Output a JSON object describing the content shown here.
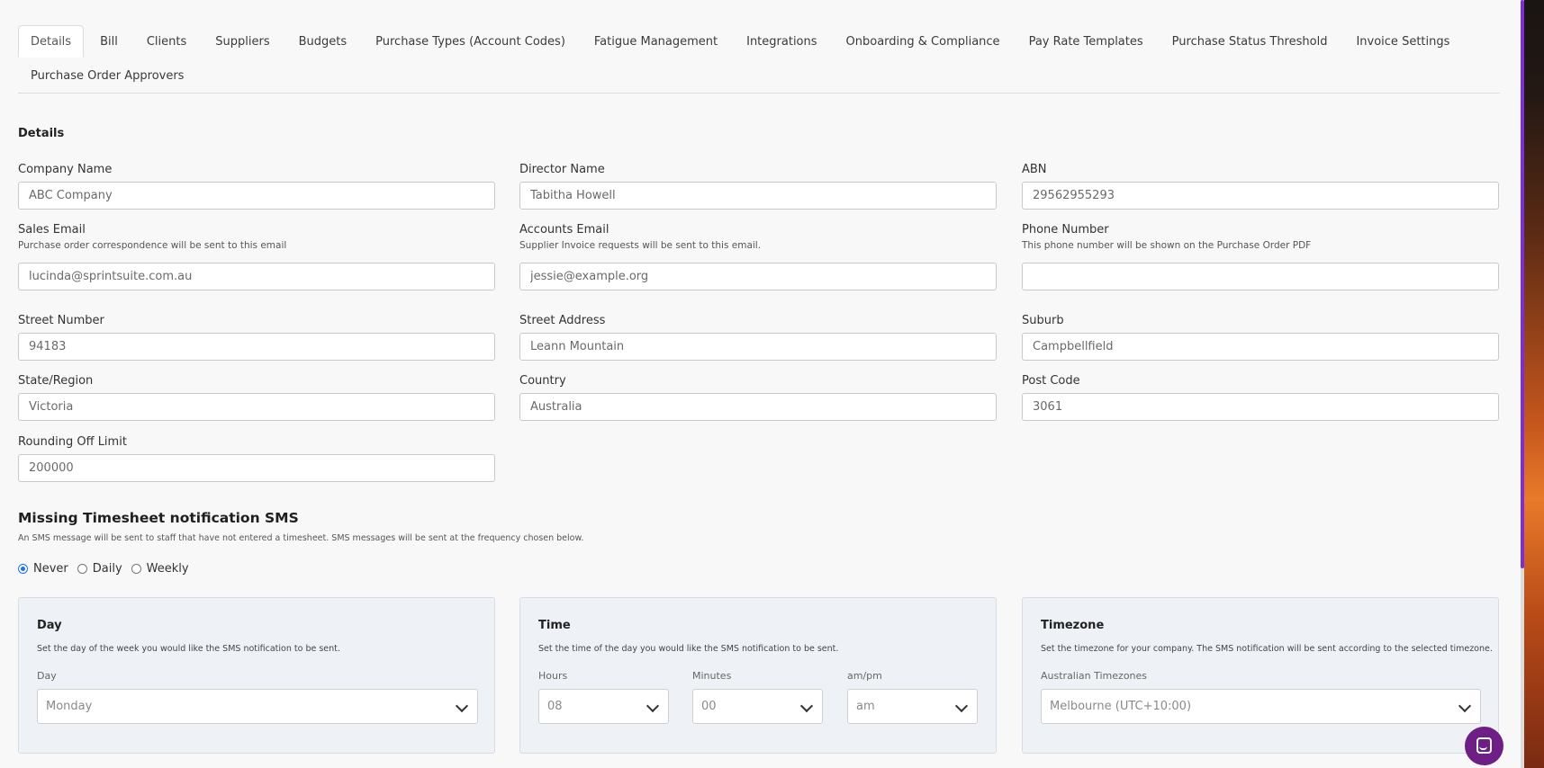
{
  "tabs": {
    "row1": [
      "Details",
      "Bill",
      "Clients",
      "Suppliers",
      "Budgets",
      "Purchase Types (Account Codes)",
      "Fatigue Management",
      "Integrations",
      "Onboarding & Compliance",
      "Pay Rate Templates",
      "Purchase Status Threshold",
      "Invoice Settings"
    ],
    "row2": [
      "Purchase Order Approvers"
    ],
    "active": "Details"
  },
  "details": {
    "title": "Details",
    "company_name": {
      "label": "Company Name",
      "value": "ABC Company"
    },
    "director_name": {
      "label": "Director Name",
      "value": "Tabitha Howell"
    },
    "abn": {
      "label": "ABN",
      "value": "29562955293"
    },
    "sales_email": {
      "label": "Sales Email",
      "help": "Purchase order correspondence will be sent to this email",
      "value": "lucinda@sprintsuite.com.au"
    },
    "accounts_email": {
      "label": "Accounts Email",
      "help": "Supplier Invoice requests will be sent to this email.",
      "value": "jessie@example.org"
    },
    "phone_number": {
      "label": "Phone Number",
      "help": "This phone number will be shown on the Purchase Order PDF",
      "value": ""
    },
    "street_number": {
      "label": "Street Number",
      "value": "94183"
    },
    "street_address": {
      "label": "Street Address",
      "value": "Leann Mountain"
    },
    "suburb": {
      "label": "Suburb",
      "value": "Campbellfield"
    },
    "state_region": {
      "label": "State/Region",
      "value": "Victoria"
    },
    "country": {
      "label": "Country",
      "value": "Australia"
    },
    "post_code": {
      "label": "Post Code",
      "value": "3061"
    },
    "rounding_off_limit": {
      "label": "Rounding Off Limit",
      "value": "200000"
    }
  },
  "sms": {
    "title": "Missing Timesheet notification SMS",
    "description": "An SMS message will be sent to staff that have not entered a timesheet. SMS messages will be sent at the frequency chosen below.",
    "frequency_options": [
      "Never",
      "Daily",
      "Weekly"
    ],
    "selected_frequency": "Never",
    "day_card": {
      "title": "Day",
      "description": "Set the day of the week you would like the SMS notification to be sent.",
      "field_label": "Day",
      "value": "Monday"
    },
    "time_card": {
      "title": "Time",
      "description": "Set the time of the day you would like the SMS notification to be sent.",
      "hours_label": "Hours",
      "hours_value": "08",
      "minutes_label": "Minutes",
      "minutes_value": "00",
      "ampm_label": "am/pm",
      "ampm_value": "am"
    },
    "timezone_card": {
      "title": "Timezone",
      "description": "Set the timezone for your company. The SMS notification will be sent according to the selected timezone.",
      "field_label": "Australian Timezones",
      "value": "Melbourne (UTC+10:00)"
    }
  },
  "icons": {
    "chevron": "chevron-down-icon",
    "chat": "chat-icon"
  },
  "colors": {
    "accent": "#1a73e8",
    "scrollbar": "#7c2fd6",
    "chat_button": "#6d1f86"
  }
}
